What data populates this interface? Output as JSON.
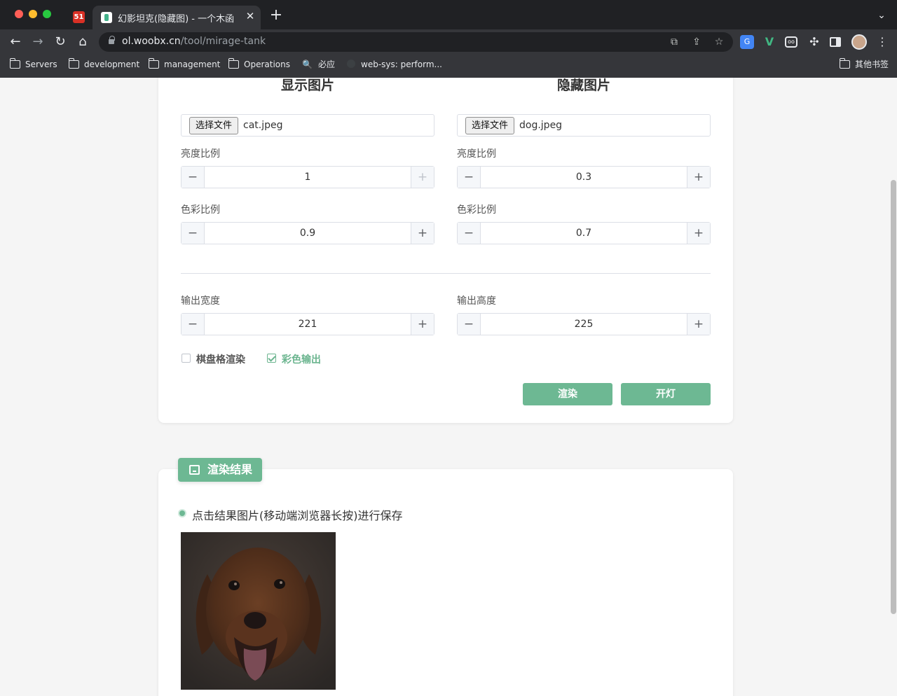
{
  "browser": {
    "pinned_tab_label": "51",
    "tab_title": "幻影坦克(隐藏图) - 一个木函",
    "url_host": "ol.woobx.cn",
    "url_path": "/tool/mirage-tank",
    "bookmarks": [
      "Servers",
      "development",
      "management",
      "Operations",
      "必应",
      "web-sys: perform...",
      "其他书签"
    ]
  },
  "settings": {
    "display_title": "显示图片",
    "hidden_title": "隐藏图片",
    "choose_file_label": "选择文件",
    "display_file": "cat.jpeg",
    "hidden_file": "dog.jpeg",
    "brightness_label": "亮度比例",
    "color_label": "色彩比例",
    "display_brightness": "1",
    "hidden_brightness": "0.3",
    "display_color": "0.9",
    "hidden_color": "0.7",
    "output_width_label": "输出宽度",
    "output_height_label": "输出高度",
    "output_width": "221",
    "output_height": "225",
    "checkerboard_label": "棋盘格渲染",
    "color_output_label": "彩色输出",
    "render_button": "渲染",
    "light_button": "开灯"
  },
  "result": {
    "tag_label": "渲染结果",
    "hint": "点击结果图片(移动端浏览器长按)进行保存"
  },
  "colors": {
    "accent": "#6db893",
    "chrome_dark": "#202124"
  }
}
